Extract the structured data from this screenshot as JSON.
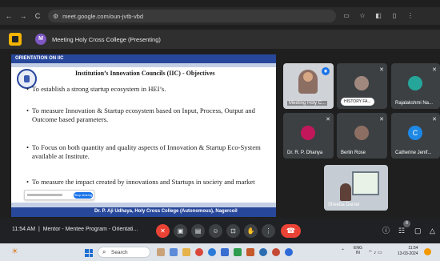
{
  "browser": {
    "url": "meet.google.com/oun-jvtb-vbd",
    "back_icon": "←",
    "forward_icon": "→",
    "reload_icon": "C"
  },
  "meet": {
    "presenter_initial": "M",
    "meeting_title": "Meeting Holy Cross College (Presenting)",
    "time": "11:54 AM",
    "separator": "|",
    "meeting_name": "Mentor - Mentee Program - Orientati..."
  },
  "slide": {
    "header": "ORIENTATION ON IIC",
    "heading": "Institution’s Innovation Councils (IIC) - Objectives",
    "bullets": [
      "To establish a strong startup ecosystem in HEI’s.",
      "To measure Innovation & Startup ecosystem based on Input, Process, Output and Outcome based parameters.",
      "To Focus on both quantity and quality aspects of Innovation & Startup Eco-System available at Institute.",
      "To measure the impact created by innovations and Startups in society and market"
    ],
    "stop_sharing": "Stop sharing",
    "footer": "Dr. P. Aji Udhaya, Holy Cross College (Autonomous), Nagercoil"
  },
  "participants": [
    {
      "name": "Meeting Holy C...",
      "speaking": true
    },
    {
      "name": "HISTORY FA...",
      "muted": true
    },
    {
      "name": "Rajalakshmi Na...",
      "muted": true
    },
    {
      "name": "Dr. R. P. Dhanya",
      "muted": true
    },
    {
      "name": "Berlin Rose",
      "muted": true
    },
    {
      "name": "Catherine Jenif...",
      "muted": true,
      "initial": "C"
    },
    {
      "name": "Sheeba Daniel"
    }
  ],
  "controls": {
    "people_count": "8"
  },
  "taskbar": {
    "search_label": "Search",
    "lang_line1": "ENG",
    "lang_line2": "IN",
    "clock_time": "11:54",
    "clock_date": "13-03-2024"
  },
  "colors": {
    "slide_blue": "#27479b",
    "end_call_red": "#ea4335",
    "accent_blue": "#1a73e8"
  }
}
